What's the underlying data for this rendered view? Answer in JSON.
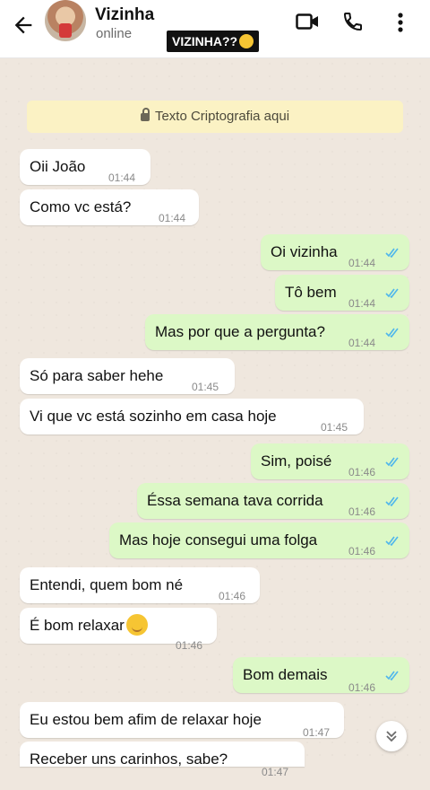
{
  "header": {
    "contact_name": "Vizinha",
    "status": "online",
    "overlay_tag": "VIZINHA??"
  },
  "notice": {
    "text": "Texto Criptografia aqui"
  },
  "messages": [
    {
      "dir": "in",
      "text": "Oii João",
      "time": "01:44"
    },
    {
      "dir": "in",
      "text": "Como vc está?",
      "time": "01:44"
    },
    {
      "dir": "out",
      "text": "Oi vizinha",
      "time": "01:44"
    },
    {
      "dir": "out",
      "text": "Tô bem",
      "time": "01:44"
    },
    {
      "dir": "out",
      "text": "Mas por que a pergunta?",
      "time": "01:44"
    },
    {
      "dir": "in",
      "text": "Só para saber hehe",
      "time": "01:45"
    },
    {
      "dir": "in",
      "text": "Vi que vc está sozinho em casa hoje",
      "time": "01:45"
    },
    {
      "dir": "out",
      "text": "Sim, poisé",
      "time": "01:46"
    },
    {
      "dir": "out",
      "text": "Éssa semana tava corrida",
      "time": "01:46"
    },
    {
      "dir": "out",
      "text": "Mas hoje consegui uma folga",
      "time": "01:46"
    },
    {
      "dir": "in",
      "text": "Entendi, quem bom né",
      "time": "01:46"
    },
    {
      "dir": "in",
      "text": "É bom relaxar",
      "time": "01:46",
      "emoji": "relieved-face"
    },
    {
      "dir": "out",
      "text": "Bom demais",
      "time": "01:46"
    },
    {
      "dir": "in",
      "text": "Eu estou bem afim de relaxar hoje",
      "time": "01:47"
    },
    {
      "dir": "in",
      "text": "Receber uns carinhos, sabe?",
      "time": "01:47"
    }
  ],
  "colors": {
    "incoming": "#ffffff",
    "outgoing": "#dcf8c6",
    "read_ticks": "#4fb6ec",
    "chat_bg": "#efe7de"
  }
}
